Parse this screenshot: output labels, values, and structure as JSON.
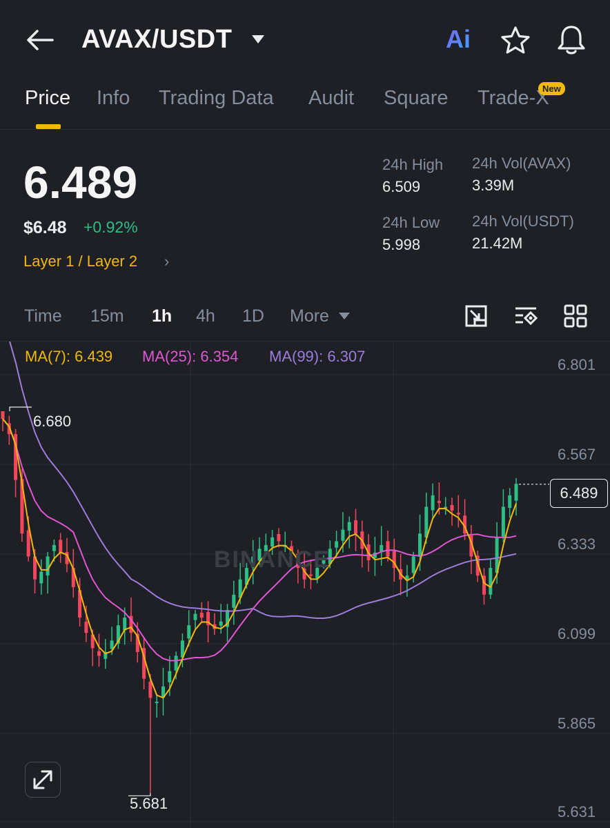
{
  "header": {
    "pair": "AVAX/USDT",
    "ai_label": "Ai"
  },
  "tabs": [
    {
      "label": "Price",
      "active": true
    },
    {
      "label": "Info"
    },
    {
      "label": "Trading Data"
    },
    {
      "label": "Audit"
    },
    {
      "label": "Square"
    },
    {
      "label": "Trade-X",
      "badge": "New"
    }
  ],
  "price": {
    "last": "6.489",
    "fiat": "$6.48",
    "change": "+0.92%",
    "tag": "Layer 1 / Layer 2"
  },
  "stats": {
    "high_label": "24h High",
    "high": "6.509",
    "low_label": "24h Low",
    "low": "5.998",
    "vol_base_label": "24h Vol(AVAX)",
    "vol_base": "3.39M",
    "vol_quote_label": "24h Vol(USDT)",
    "vol_quote": "21.42M"
  },
  "timeframes": [
    "Time",
    "15m",
    "1h",
    "4h",
    "1D",
    "More"
  ],
  "active_timeframe": "1h",
  "ma": {
    "ma7": "MA(7): 6.439",
    "ma25": "MA(25): 6.354",
    "ma99": "MA(99): 6.307"
  },
  "axis": [
    "6.801",
    "6.567",
    "6.333",
    "6.099",
    "5.865",
    "5.631"
  ],
  "current_price_tag": "6.489",
  "extremes": {
    "high": "6.680",
    "low": "5.681"
  },
  "watermark": "BINANCE",
  "colors": {
    "up": "#2ebd85",
    "down": "#f6465d",
    "accent": "#f0b90b",
    "ma7": "#f0b90b",
    "ma25": "#e056d4",
    "ma99": "#9b7ddb"
  },
  "icons": [
    "back-arrow-icon",
    "caret-down-icon",
    "star-icon",
    "bell-icon",
    "chart-settings-icon",
    "indicator-icon",
    "grid-icon",
    "expand-icon"
  ],
  "chart_data": {
    "type": "candlestick",
    "interval": "1h",
    "ylim": [
      5.631,
      6.801
    ],
    "closes": [
      6.66,
      6.62,
      6.5,
      6.36,
      6.3,
      6.24,
      6.26,
      6.3,
      6.33,
      6.31,
      6.28,
      6.22,
      6.14,
      6.1,
      6.06,
      6.04,
      6.05,
      6.08,
      6.12,
      6.14,
      6.1,
      6.05,
      5.98,
      5.93,
      5.92,
      5.96,
      6.0,
      6.04,
      6.08,
      6.12,
      6.15,
      6.14,
      6.12,
      6.11,
      6.13,
      6.16,
      6.2,
      6.24,
      6.27,
      6.3,
      6.32,
      6.33,
      6.35,
      6.34,
      6.33,
      6.31,
      6.27,
      6.24,
      6.25,
      6.27,
      6.29,
      6.32,
      6.34,
      6.37,
      6.39,
      6.36,
      6.32,
      6.29,
      6.31,
      6.33,
      6.3,
      6.27,
      6.24,
      6.25,
      6.3,
      6.36,
      6.43,
      6.46,
      6.44,
      6.43,
      6.42,
      6.41,
      6.36,
      6.3,
      6.25,
      6.2,
      6.27,
      6.35,
      6.43,
      6.46,
      6.49
    ],
    "ma7_last": 6.439,
    "ma25_last": 6.354,
    "ma99_last": 6.307,
    "high": 6.68,
    "low": 5.681
  }
}
